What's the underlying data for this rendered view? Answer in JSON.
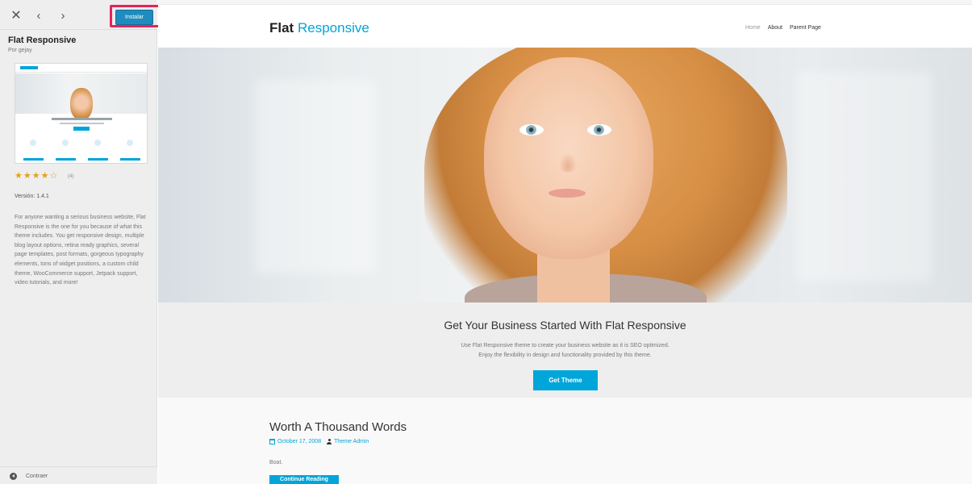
{
  "customizer": {
    "install_label": "Instalar",
    "theme_name": "Flat Responsive",
    "author": "Por gejay",
    "rating": {
      "value": 4,
      "max": 5,
      "count_label": "(4)"
    },
    "version": "Versión: 1.4.1",
    "description": "For anyone wanting a serious business website, Flat Responsive is the one for you because of what this theme includes. You get responsive design, multiple blog layout options, retina ready graphics, several page templates, post formats, gorgeous typography elements, tons of widget positions, a custom child theme, WooCommerce support, Jetpack support, video tutorials, and more!",
    "collapse_label": "Contraer",
    "icons": {
      "close": "close-icon",
      "prev": "chevron-left-icon",
      "next": "chevron-right-icon",
      "collapse": "collapse-icon"
    }
  },
  "site": {
    "brand_main": "Flat",
    "brand_accent": "Responsive",
    "menu": [
      {
        "label": "Home",
        "active": true
      },
      {
        "label": "About",
        "active": false
      },
      {
        "label": "Parent Page",
        "active": false
      }
    ],
    "cta": {
      "title": "Get Your Business Started With Flat Responsive",
      "line1": "Use Flat Responsive theme to create your business website as it is SEO optimized.",
      "line2": "Enjoy the flexibility in design and functionality provided by this theme.",
      "button": "Get Theme"
    },
    "post": {
      "title": "Worth A Thousand Words",
      "date": "October 17, 2008",
      "author": "Theme Admin",
      "excerpt": "Boat.",
      "read_more": "Continue Reading"
    }
  },
  "colors": {
    "accent": "#00a5d9",
    "install": "#1e8cbe",
    "highlight": "#e3245c",
    "star": "#e6a217"
  }
}
